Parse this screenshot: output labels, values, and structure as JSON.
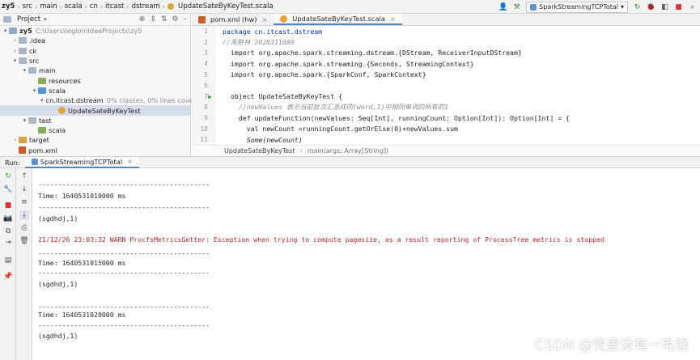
{
  "breadcrumbs": [
    "zy5",
    "src",
    "main",
    "scala",
    "cn",
    "itcast",
    "dstream",
    "UpdateSateByKeyTest.scala"
  ],
  "run_config": {
    "label": "SparkStreamingTCPTotal"
  },
  "project_panel": {
    "title": "Project",
    "tree": [
      {
        "label": "zy5",
        "hint": "C:\\Users\\leglon\\IdeaProjects\\zy5",
        "kind": "module"
      },
      {
        "label": ".idea",
        "hint": "",
        "kind": "folder"
      },
      {
        "label": "ck",
        "hint": "",
        "kind": "folder"
      },
      {
        "label": "src",
        "hint": "",
        "kind": "folder"
      },
      {
        "label": "main",
        "hint": "",
        "kind": "folder"
      },
      {
        "label": "resources",
        "hint": "",
        "kind": "folder"
      },
      {
        "label": "scala",
        "hint": "",
        "kind": "folder"
      },
      {
        "label": "cn.itcast.dstream",
        "hint": "0% classes, 0% lines coverec",
        "kind": "package"
      },
      {
        "label": "UpdateSateByKeyTest",
        "hint": "",
        "kind": "file"
      },
      {
        "label": "test",
        "hint": "",
        "kind": "folder"
      },
      {
        "label": "scala",
        "hint": "",
        "kind": "folder"
      },
      {
        "label": "target",
        "hint": "",
        "kind": "folder"
      },
      {
        "label": "pom.xml",
        "hint": "",
        "kind": "xml"
      }
    ]
  },
  "editor": {
    "tabs": [
      {
        "label": "pom.xml (hw)"
      },
      {
        "label": "UpdateSateByKeyTest.scala"
      }
    ],
    "line_numbers": [
      "1",
      "2",
      "3",
      "4",
      "5",
      "6",
      "7",
      "8",
      "9",
      "10",
      "11"
    ],
    "code": [
      {
        "t": "package cn.itcast.dstream"
      },
      {
        "t": "//朱胜林 2028311689"
      },
      {
        "t": "import org.apache.spark.streaming.dstream.{DStream, ReceiverInputDStream}"
      },
      {
        "t": "import org.apache.spark.streaming.{Seconds, StreamingContext}"
      },
      {
        "t": "import org.apache.spark.{SparkConf, SparkContext}"
      },
      {
        "t": ""
      },
      {
        "t": "object UpdateSateByKeyTest {"
      },
      {
        "t": "  //newValues 表示当前批次汇总成的(word,1)中相同单词的所有的1"
      },
      {
        "t": "  def updateFunction(newValues: Seq[Int], runningCount: Option[Int]): Option[Int] = {"
      },
      {
        "t": "    val newCount =runningCount.getOrElse(0)+newValues.sum"
      },
      {
        "t": "    Some(newCount)"
      }
    ],
    "footer_crumbs": [
      "UpdateSateByKeyTest",
      "main(args: Array[String])"
    ]
  },
  "run_panel": {
    "label": "Run:",
    "tab": "SparkStreamingTCPTotal",
    "console": [
      {
        "t": "-------------------------------------------"
      },
      {
        "t": "Time: 1640531010000 ms"
      },
      {
        "t": "-------------------------------------------"
      },
      {
        "t": "(sgdhdj,1)"
      },
      {
        "t": ""
      },
      {
        "t": "21/12/26 23:03:32 WARN ProcfsMetricsGetter: Exception when trying to compute pagesize, as a result reporting of ProcessTree metrics is stopped"
      },
      {
        "t": "-------------------------------------------"
      },
      {
        "t": "Time: 1640531015000 ms"
      },
      {
        "t": "-------------------------------------------"
      },
      {
        "t": "(sgdhdj,1)"
      },
      {
        "t": ""
      },
      {
        "t": "-------------------------------------------"
      },
      {
        "t": "Time: 1640531020000 ms"
      },
      {
        "t": "-------------------------------------------"
      },
      {
        "t": "(sgdhdj,1)"
      }
    ]
  },
  "watermark": "CSDN @兜里没有一毛钱",
  "colors": {
    "accent": "#4a88c7",
    "warn": "#b0262a",
    "keyword": "#0033b3"
  }
}
